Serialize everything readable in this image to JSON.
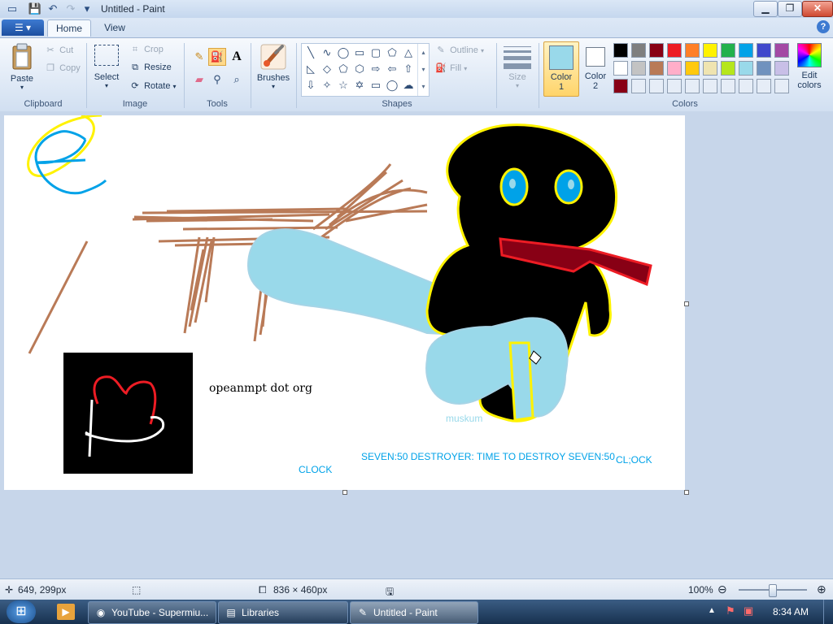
{
  "window": {
    "title": "Untitled - Paint",
    "controls": {
      "minimize": "▁",
      "maximize": "❐",
      "close": "✕"
    }
  },
  "quick_access": {
    "save_icon": "💾",
    "undo_icon": "↶",
    "redo_icon": "↷",
    "dropdown_icon": "▾"
  },
  "tabs": [
    {
      "label": "Home",
      "active": true
    },
    {
      "label": "View",
      "active": false
    }
  ],
  "app_menu_icon": "☰ ▾",
  "help_icon": "?",
  "ribbon": {
    "clipboard": {
      "label": "Clipboard",
      "paste": "Paste",
      "cut": "Cut",
      "copy": "Copy"
    },
    "image": {
      "label": "Image",
      "select": "Select",
      "crop": "Crop",
      "resize": "Resize",
      "rotate": "Rotate"
    },
    "tools": {
      "label": "Tools",
      "text_tool": "A"
    },
    "brushes": {
      "label": "Brushes"
    },
    "shapes": {
      "label": "Shapes",
      "outline": "Outline",
      "fill": "Fill"
    },
    "size": {
      "label": "Size"
    },
    "color1": {
      "label": "Color",
      "num": "1",
      "value": "#99d9ea"
    },
    "color2": {
      "label": "Color",
      "num": "2",
      "value": "#ffffff"
    },
    "colors": {
      "label": "Colors",
      "edit_label": "Edit",
      "edit_label2": "colors",
      "palette_row1": [
        "#000000",
        "#7f7f7f",
        "#880015",
        "#ed1c24",
        "#ff7f27",
        "#fff200",
        "#22b14c",
        "#00a2e8",
        "#3f48cc",
        "#a349a4"
      ],
      "palette_row2": [
        "#ffffff",
        "#c3c3c3",
        "#b97a57",
        "#ffaec9",
        "#ffc90e",
        "#efe4b0",
        "#b5e61d",
        "#99d9ea",
        "#7092be",
        "#c8bfe7"
      ],
      "palette_row3": [
        "#880015",
        "#e6edf7",
        "#e6edf7",
        "#e6edf7",
        "#e6edf7",
        "#e6edf7",
        "#e6edf7",
        "#e6edf7",
        "#e6edf7",
        "#e6edf7"
      ]
    }
  },
  "canvas_text": {
    "opean": "opeanmpt dot org",
    "muskum": "muskum",
    "seven": "SEVEN:50 DESTROYER: TIME TO DESTROY SEVEN:50",
    "clock": "CLOCK",
    "clock2": "CL;OCK"
  },
  "status": {
    "cursor_pos": "649, 299px",
    "selection_size": "",
    "canvas_size": "836 × 460px",
    "zoom": "100%",
    "zoom_level": 0.5
  },
  "taskbar": {
    "start_icon": "⊞",
    "items": [
      {
        "label": "YouTube - Supermiu...",
        "icon": "◉"
      },
      {
        "label": "Libraries",
        "icon": "▤"
      },
      {
        "label": "Untitled - Paint",
        "icon": "✎"
      }
    ],
    "tray_icons": [
      "▲",
      "⚑",
      "▣"
    ],
    "clock": "8:34 AM"
  }
}
